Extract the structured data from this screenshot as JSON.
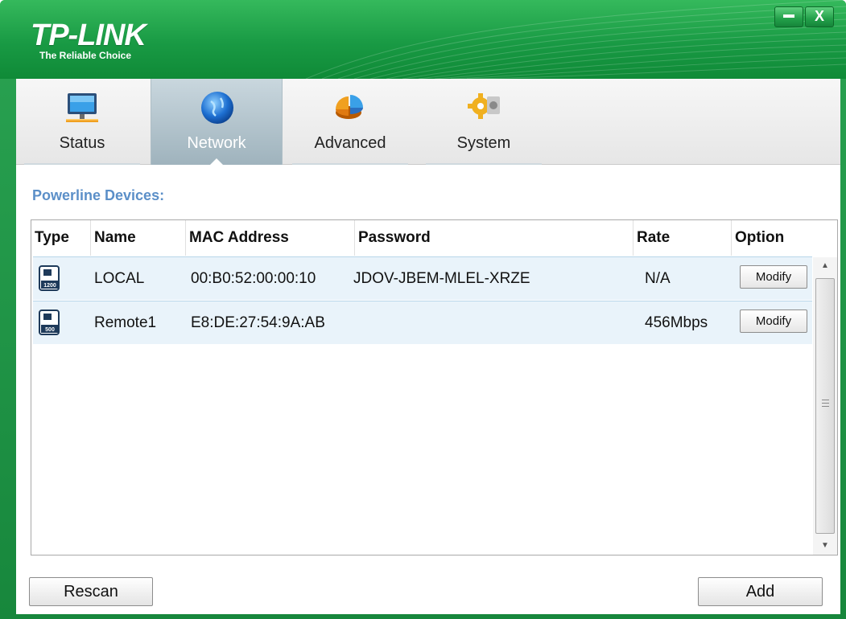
{
  "window": {
    "brand": "TP-LINK",
    "tagline": "The Reliable Choice",
    "minimize_icon": "minimize-icon",
    "close_label": "X"
  },
  "tabs": [
    {
      "label": "Status",
      "icon": "monitor-icon",
      "active": false
    },
    {
      "label": "Network",
      "icon": "globe-icon",
      "active": true
    },
    {
      "label": "Advanced",
      "icon": "pie-chart-icon",
      "active": false
    },
    {
      "label": "System",
      "icon": "gears-icon",
      "active": false
    }
  ],
  "section": {
    "title": "Powerline Devices:"
  },
  "table": {
    "columns": [
      "Type",
      "Name",
      "MAC Address",
      "Password",
      "Rate",
      "Option"
    ],
    "rows": [
      {
        "type_badge": "1200",
        "name": "LOCAL",
        "mac": "00:B0:52:00:00:10",
        "password": "JDOV-JBEM-MLEL-XRZE",
        "rate": "N/A",
        "option": "Modify"
      },
      {
        "type_badge": "500",
        "name": "Remote1",
        "mac": "E8:DE:27:54:9A:AB",
        "password": "",
        "rate": "456Mbps",
        "option": "Modify"
      }
    ]
  },
  "buttons": {
    "rescan": "Rescan",
    "add": "Add"
  },
  "colors": {
    "brand_green": "#199a44",
    "section_title": "#5b8fc8",
    "row_bg": "#e9f3fa"
  }
}
